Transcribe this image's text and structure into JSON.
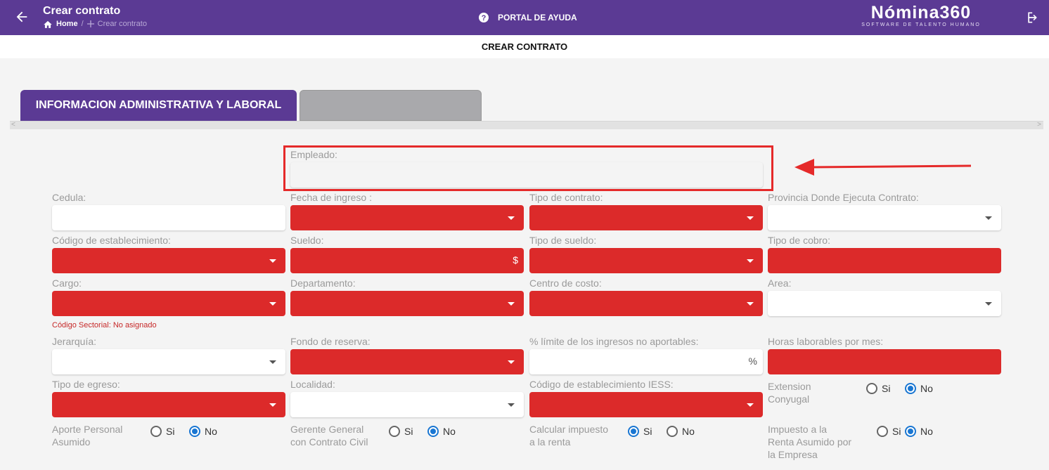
{
  "header": {
    "title": "Crear contrato",
    "crumb_home": "Home",
    "crumb_sep": "/",
    "crumb_current": "Crear contrato",
    "help": "PORTAL DE AYUDA",
    "logo_main": "Nómina360",
    "logo_sub": "SOFTWARE DE TALENTO HUMANO"
  },
  "subtitle": "CREAR CONTRATO",
  "tabs": {
    "active": "INFORMACION ADMINISTRATIVA Y LABORAL",
    "second": ""
  },
  "fields": {
    "empleado": "Empleado:",
    "cedula": "Cedula:",
    "fecha_ingreso": "Fecha de ingreso :",
    "tipo_contrato": "Tipo de contrato:",
    "provincia": "Provincia Donde Ejecuta Contrato:",
    "codigo_establecimiento": "Código de establecimiento:",
    "sueldo": "Sueldo:",
    "sueldo_suffix": "$",
    "tipo_sueldo": "Tipo de sueldo:",
    "tipo_cobro": "Tipo de cobro:",
    "cargo": "Cargo:",
    "departamento": "Departamento:",
    "centro_costo": "Centro de costo:",
    "area": "Area:",
    "codigo_sectorial": "Código Sectorial: No asignado",
    "jerarquia": "Jerarquía:",
    "fondo_reserva": "Fondo de reserva:",
    "limite_ingresos": "% límite de los ingresos no aportables:",
    "limite_suffix": "%",
    "horas_laborables": "Horas laborables por mes:",
    "tipo_egreso": "Tipo de egreso:",
    "localidad": "Localidad:",
    "codigo_iess": "Código de establecimiento IESS:"
  },
  "radios": {
    "si": "Si",
    "no": "No",
    "extension_conyugal_1": "Extension",
    "extension_conyugal_2": "Conyugal",
    "aporte_1": "Aporte Personal",
    "aporte_2": "Asumido",
    "gerente_1": "Gerente General",
    "gerente_2": "con Contrato Civil",
    "calcular_1": "Calcular impuesto",
    "calcular_2": "a la renta",
    "impuesto_1": "Impuesto a la",
    "impuesto_2": "Renta Asumido por",
    "impuesto_3": "la Empresa"
  },
  "colors": {
    "header": "#5b3a94",
    "required": "#dc2a2a",
    "highlight": "#e52a2a",
    "radio": "#1976d2"
  }
}
